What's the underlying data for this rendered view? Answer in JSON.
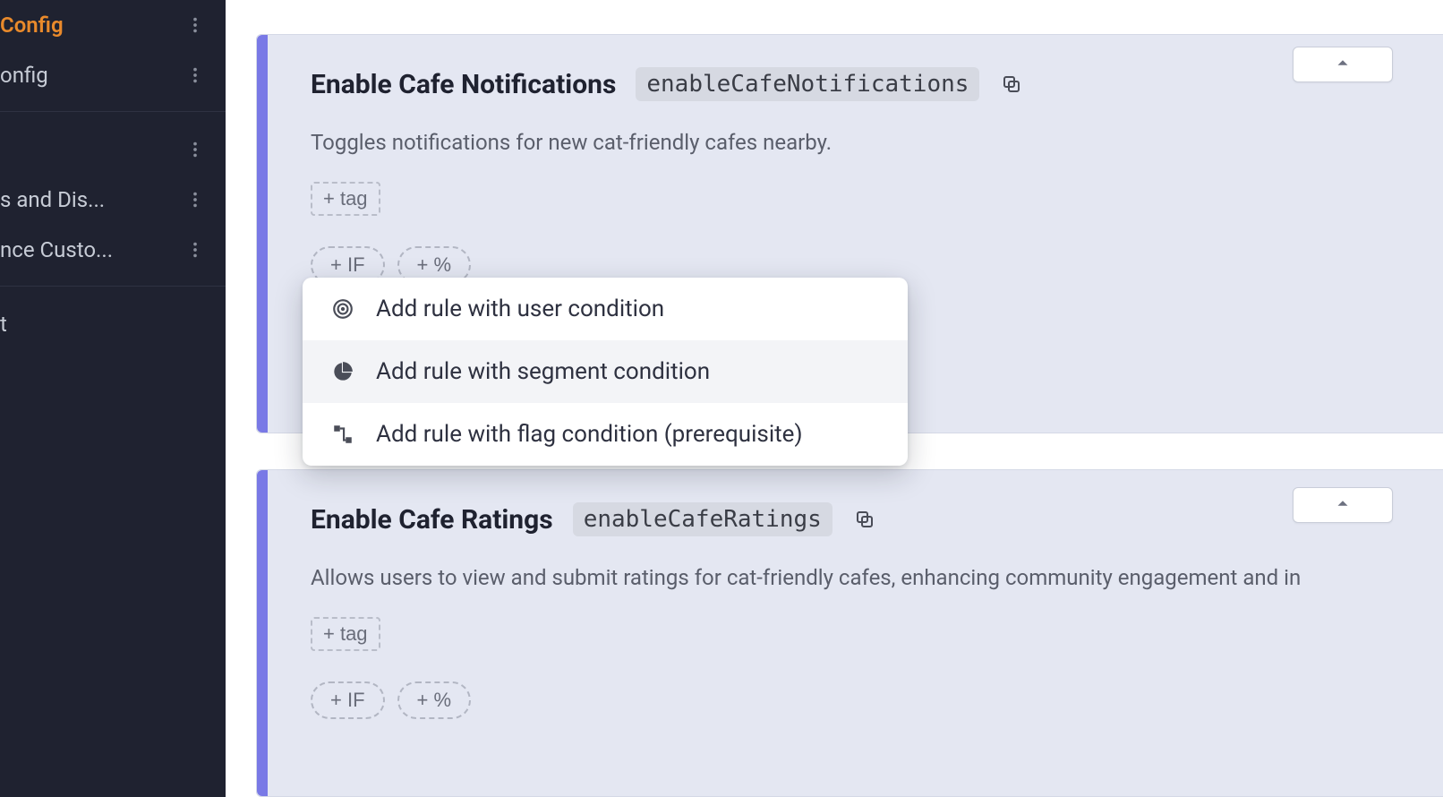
{
  "sidebar": {
    "items": [
      {
        "label": "Config"
      },
      {
        "label": "onfig"
      },
      {
        "label": ""
      },
      {
        "label": "s and Dis..."
      },
      {
        "label": "nce Custo..."
      },
      {
        "label": "t"
      }
    ]
  },
  "flags": [
    {
      "title": "Enable Cafe Notifications",
      "key": "enableCafeNotifications",
      "description": "Toggles notifications for new cat-friendly cafes nearby.",
      "tag_button": "+ tag",
      "chips": {
        "if": "+ IF",
        "pct": "+ %"
      }
    },
    {
      "title": "Enable Cafe Ratings",
      "key": "enableCafeRatings",
      "description": "Allows users to view and submit ratings for cat-friendly cafes, enhancing community engagement and in",
      "tag_button": "+ tag",
      "chips": {
        "if": "+ IF",
        "pct": "+ %"
      }
    }
  ],
  "popover": {
    "items": [
      {
        "label": "Add rule with user condition"
      },
      {
        "label": "Add rule with segment condition"
      },
      {
        "label": "Add rule with flag condition (prerequisite)"
      }
    ]
  }
}
